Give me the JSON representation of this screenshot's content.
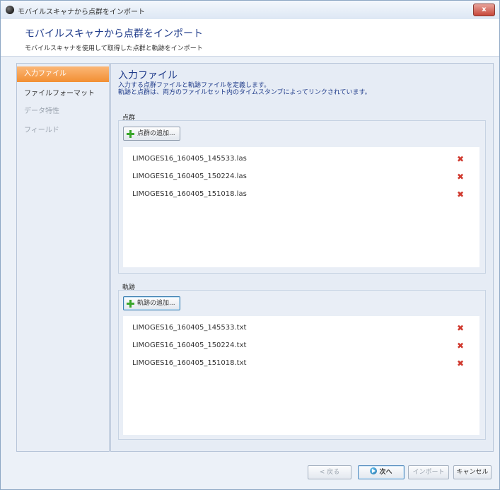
{
  "window": {
    "title": "モバイルスキャナから点群をインポート",
    "close_label": "x"
  },
  "header": {
    "title": "モバイルスキャナから点群をインポート",
    "subtitle": "モバイルスキャナを使用して取得した点群と軌跡をインポート"
  },
  "sidebar": {
    "items": [
      {
        "label": "入力ファイル",
        "state": "active"
      },
      {
        "label": "ファイルフォーマット",
        "state": "normal"
      },
      {
        "label": "データ特性",
        "state": "disabled"
      },
      {
        "label": "フィールド",
        "state": "disabled"
      }
    ]
  },
  "content": {
    "title": "入力ファイル",
    "desc_line1": "入力する点群ファイルと軌跡ファイルを定義します。",
    "desc_line2": "軌跡と点群は、両方のファイルセット内のタイムスタンプによってリンクされています。",
    "pointcloud": {
      "label": "点群",
      "add_button": "点群の追加...",
      "files": [
        "LIMOGES16_160405_145533.las",
        "LIMOGES16_160405_150224.las",
        "LIMOGES16_160405_151018.las"
      ]
    },
    "trajectory": {
      "label": "軌跡",
      "add_button": "軌跡の追加...",
      "files": [
        "LIMOGES16_160405_145533.txt",
        "LIMOGES16_160405_150224.txt",
        "LIMOGES16_160405_151018.txt"
      ]
    }
  },
  "footer": {
    "back": "< 戻る",
    "next": "次へ",
    "import": "インポート",
    "cancel": "キャンセル"
  },
  "colors": {
    "accent": "#f28f33",
    "title_blue": "#1f3b8a",
    "remove_red": "#d03a2f"
  }
}
